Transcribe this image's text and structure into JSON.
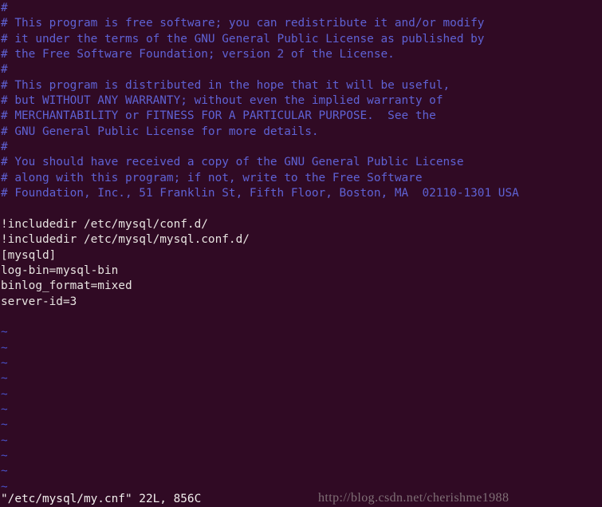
{
  "terminal": {
    "background_color": "#300a24",
    "comment_color": "#5f62d4",
    "text_color": "#e8e4e1",
    "tilde_color": "#4a52c8",
    "status_color": "#f2efed",
    "watermark_color": "#8d8184"
  },
  "editor": {
    "name": "vim",
    "filename": "/etc/mysql/my.cnf",
    "lines": [
      {
        "text": "#",
        "kind": "comment"
      },
      {
        "text": "# This program is free software; you can redistribute it and/or modify",
        "kind": "comment"
      },
      {
        "text": "# it under the terms of the GNU General Public License as published by",
        "kind": "comment"
      },
      {
        "text": "# the Free Software Foundation; version 2 of the License.",
        "kind": "comment"
      },
      {
        "text": "#",
        "kind": "comment"
      },
      {
        "text": "# This program is distributed in the hope that it will be useful,",
        "kind": "comment"
      },
      {
        "text": "# but WITHOUT ANY WARRANTY; without even the implied warranty of",
        "kind": "comment"
      },
      {
        "text": "# MERCHANTABILITY or FITNESS FOR A PARTICULAR PURPOSE.  See the",
        "kind": "comment"
      },
      {
        "text": "# GNU General Public License for more details.",
        "kind": "comment"
      },
      {
        "text": "#",
        "kind": "comment"
      },
      {
        "text": "# You should have received a copy of the GNU General Public License",
        "kind": "comment"
      },
      {
        "text": "# along with this program; if not, write to the Free Software",
        "kind": "comment"
      },
      {
        "text": "# Foundation, Inc., 51 Franklin St, Fifth Floor, Boston, MA  02110-1301 USA",
        "kind": "comment"
      },
      {
        "text": "",
        "kind": "blank"
      },
      {
        "text": "!includedir /etc/mysql/conf.d/",
        "kind": "normal"
      },
      {
        "text": "!includedir /etc/mysql/mysql.conf.d/",
        "kind": "normal"
      },
      {
        "text": "[mysqld]",
        "kind": "normal"
      },
      {
        "text": "log-bin=mysql-bin",
        "kind": "normal"
      },
      {
        "text": "binlog_format=mixed",
        "kind": "normal"
      },
      {
        "text": "server-id=3",
        "kind": "normal"
      },
      {
        "text": "",
        "kind": "blank"
      },
      {
        "text": "~",
        "kind": "tilde"
      },
      {
        "text": "~",
        "kind": "tilde"
      },
      {
        "text": "~",
        "kind": "tilde"
      },
      {
        "text": "~",
        "kind": "tilde"
      },
      {
        "text": "~",
        "kind": "tilde"
      },
      {
        "text": "~",
        "kind": "tilde"
      },
      {
        "text": "~",
        "kind": "tilde"
      },
      {
        "text": "~",
        "kind": "tilde"
      },
      {
        "text": "~",
        "kind": "tilde"
      },
      {
        "text": "~",
        "kind": "tilde"
      },
      {
        "text": "~",
        "kind": "tilde"
      }
    ],
    "status_line": "\"/etc/mysql/my.cnf\" 22L, 856C",
    "status_parts": {
      "file": "\"/etc/mysql/my.cnf\"",
      "line_count": "22L",
      "char_count": "856C"
    }
  },
  "watermark": {
    "text": "http://blog.csdn.net/cherishme1988"
  }
}
